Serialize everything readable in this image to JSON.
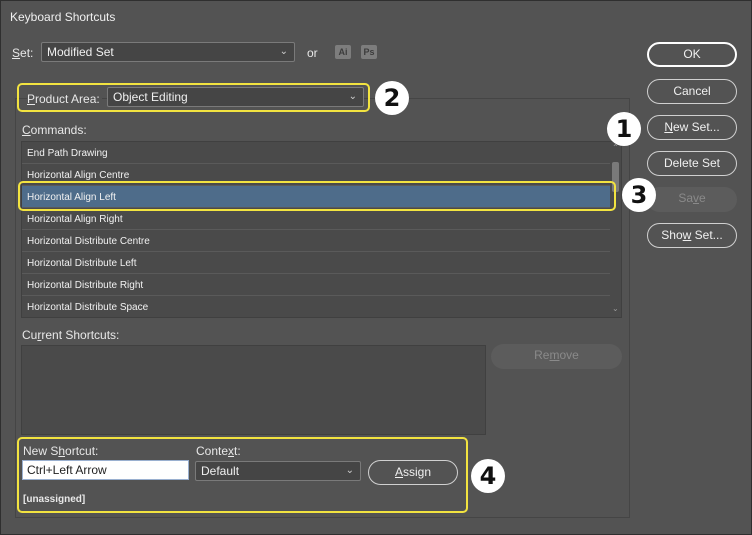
{
  "window": {
    "title": "Keyboard Shortcuts"
  },
  "set": {
    "label_prefix": "S",
    "label_rest": "et:",
    "value": "Modified Set",
    "or": "or",
    "badges": [
      "Ai",
      "Ps"
    ]
  },
  "product_area": {
    "label_prefix": "P",
    "label_rest": "roduct Area:",
    "value": "Object Editing"
  },
  "commands": {
    "label_prefix": "C",
    "label_rest": "ommands:",
    "items": [
      "End Path Drawing",
      "Horizontal Align Centre",
      "Horizontal Align Left",
      "Horizontal Align Right",
      "Horizontal Distribute Centre",
      "Horizontal Distribute Left",
      "Horizontal Distribute Right",
      "Horizontal Distribute Space"
    ],
    "selected": "Horizontal Align Left"
  },
  "current_shortcuts": {
    "label_a": "Cu",
    "label_u": "r",
    "label_b": "rent Shortcuts:",
    "remove_a": "Re",
    "remove_u": "m",
    "remove_b": "ove"
  },
  "new_shortcut": {
    "label_a": "New S",
    "label_u": "h",
    "label_b": "ortcut:",
    "value": "Ctrl+Left Arrow",
    "status": "[unassigned]"
  },
  "context": {
    "label_a": "Conte",
    "label_u": "x",
    "label_b": "t:",
    "value": "Default"
  },
  "assign": {
    "label_u": "A",
    "label_b": "ssign"
  },
  "buttons": {
    "ok": "OK",
    "cancel": "Cancel",
    "new_set_u": "N",
    "new_set_b": "ew Set...",
    "delete_set": "Delete Set",
    "save_a": "Sa",
    "save_u": "v",
    "save_b": "e",
    "show_set_a": "Sho",
    "show_set_u": "w",
    "show_set_b": " Set..."
  },
  "callouts": [
    "1",
    "2",
    "3",
    "4"
  ],
  "colors": {
    "highlight": "#f2e340",
    "selection": "#4e6c8a",
    "background": "#535353"
  }
}
